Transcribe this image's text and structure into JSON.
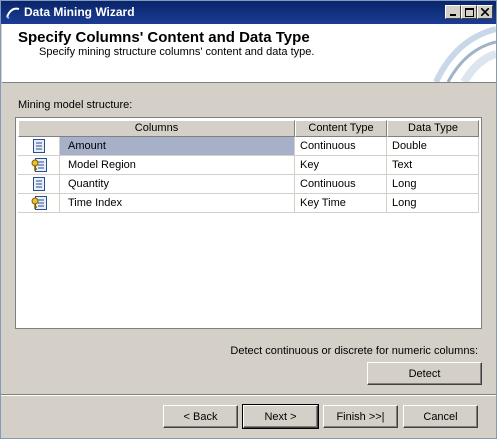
{
  "window": {
    "title": "Data Mining Wizard"
  },
  "header": {
    "title": "Specify Columns' Content and Data Type",
    "subtitle": "Specify mining structure columns' content and data type."
  },
  "structure": {
    "label": "Mining model structure:",
    "columns": [
      "Columns",
      "Content Type",
      "Data Type"
    ],
    "rows": [
      {
        "icon": "column-icon",
        "name": "Amount",
        "content_type": "Continuous",
        "data_type": "Double",
        "selected": true
      },
      {
        "icon": "key-column-icon",
        "name": "Model Region",
        "content_type": "Key",
        "data_type": "Text",
        "selected": false
      },
      {
        "icon": "column-icon",
        "name": "Quantity",
        "content_type": "Continuous",
        "data_type": "Long",
        "selected": false
      },
      {
        "icon": "key-column-icon",
        "name": "Time Index",
        "content_type": "Key Time",
        "data_type": "Long",
        "selected": false
      }
    ]
  },
  "detect": {
    "label": "Detect continuous or discrete for numeric columns:",
    "button": "Detect"
  },
  "footer": {
    "back": "< Back",
    "next": "Next >",
    "finish": "Finish >>|",
    "cancel": "Cancel"
  }
}
